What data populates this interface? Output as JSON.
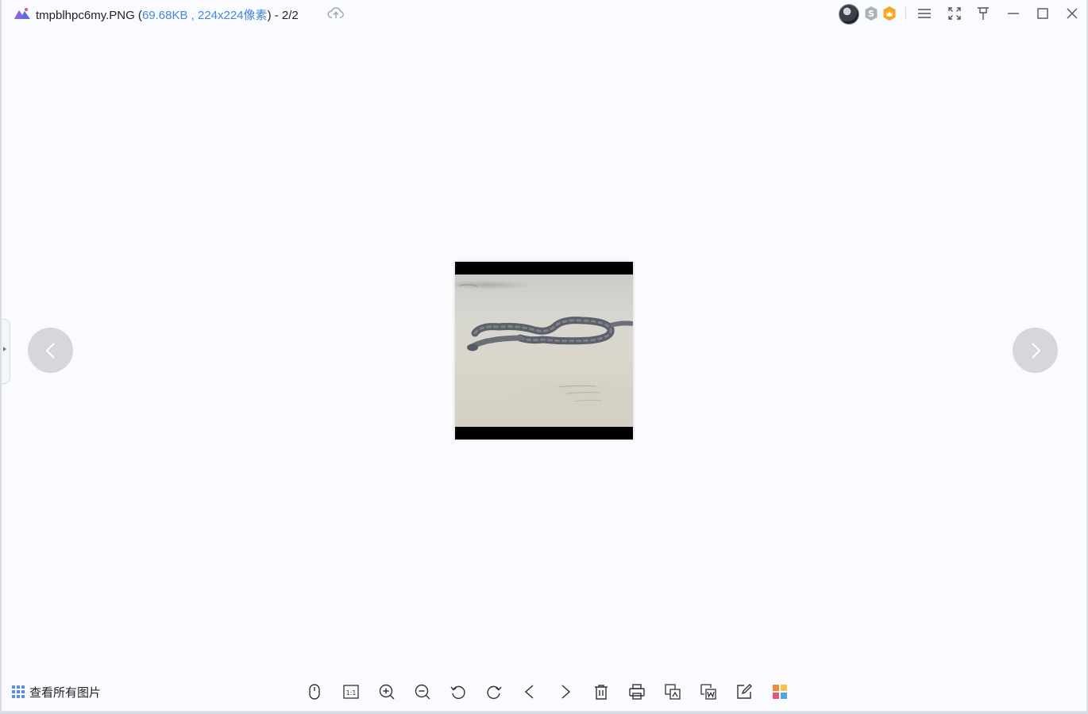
{
  "window": {
    "filename": "tmpblhpc6my.PNG",
    "open_paren": " (",
    "file_size": "69.68KB",
    "separator": " , ",
    "dimensions": "224x224像素",
    "close_paren": ")",
    "counter": " - 2/2"
  },
  "user": {
    "badge_s": "S"
  },
  "bottom": {
    "view_all_label": "查看所有图片"
  },
  "toolbar": {
    "actual_size_label": "1:1",
    "tools": [
      "mouse-mode",
      "actual-size",
      "zoom-in",
      "zoom-out",
      "rotate-left",
      "rotate-right",
      "previous",
      "next",
      "delete",
      "print",
      "convert",
      "to-word",
      "edit",
      "apps"
    ]
  },
  "colors": {
    "background": "#f9fbfe",
    "accent": "#4a86d8",
    "nav_button": "#d6d7da",
    "vip_badge": "#f5a623"
  }
}
